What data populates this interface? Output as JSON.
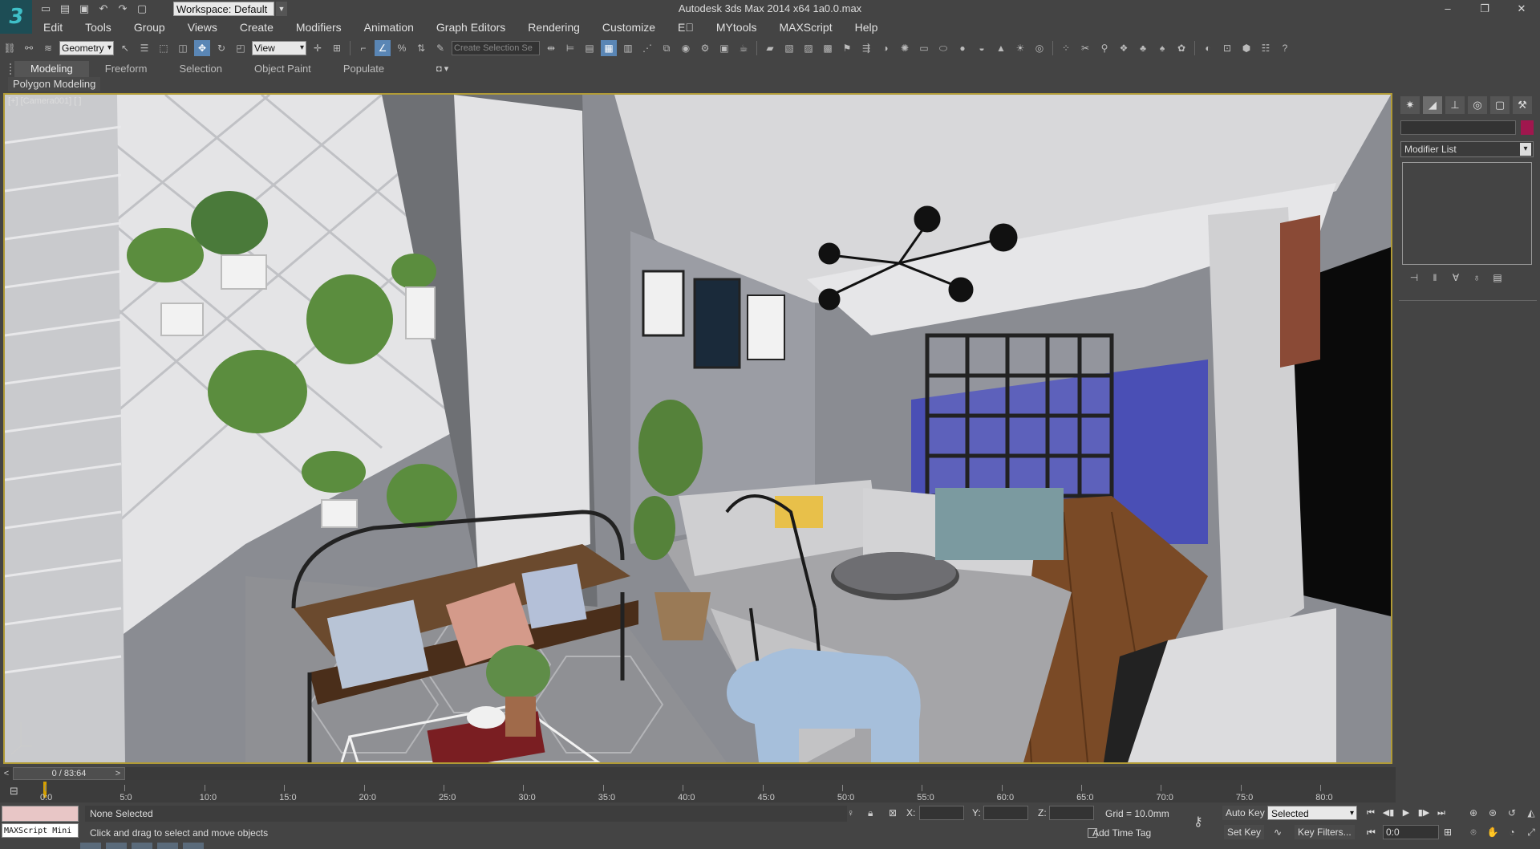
{
  "window": {
    "title": "Autodesk 3ds Max  2014 x64      1a0.0.max",
    "workspace": "Workspace: Default",
    "controls": [
      "–",
      "❐",
      "✕"
    ]
  },
  "menu": [
    "Edit",
    "Tools",
    "Group",
    "Views",
    "Create",
    "Modifiers",
    "Animation",
    "Graph Editors",
    "Rendering",
    "Customize",
    "E⃞",
    "MYtools",
    "MAXScript",
    "Help"
  ],
  "toolbar": {
    "selection_filter": "Geometry",
    "ref_coord": "View",
    "named_selection_placeholder": "Create Selection Se"
  },
  "ribbon": {
    "tabs": [
      "Modeling",
      "Freeform",
      "Selection",
      "Object Paint",
      "Populate"
    ],
    "active_tab": "Modeling",
    "panel_label": "Polygon Modeling"
  },
  "viewport": {
    "label": "[+] [Camera001] [ ]"
  },
  "command_panel": {
    "modifier_list": "Modifier List"
  },
  "time_slider": {
    "position": "0 / 83:64",
    "ticks": [
      "0:0",
      "5:0",
      "10:0",
      "15:0",
      "20:0",
      "25:0",
      "30:0",
      "35:0",
      "40:0",
      "45:0",
      "50:0",
      "55:0",
      "60:0",
      "65:0",
      "70:0",
      "75:0",
      "80:0"
    ]
  },
  "status": {
    "selection": "None Selected",
    "prompt": "Click and drag to select and move objects",
    "maxscript_label": "MAXScript Mini",
    "x_label": "X:",
    "y_label": "Y:",
    "z_label": "Z:",
    "grid": "Grid = 10.0mm",
    "add_time_tag": "Add Time Tag",
    "auto_key": "Auto Key",
    "set_key": "Set Key",
    "selected_dd": "Selected",
    "key_filters": "Key Filters...",
    "frame": "0:0"
  }
}
